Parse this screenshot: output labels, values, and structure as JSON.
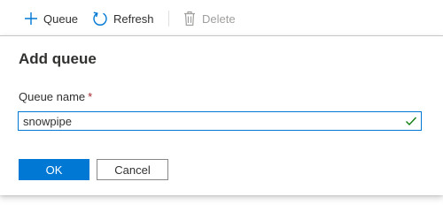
{
  "toolbar": {
    "queue_label": "Queue",
    "refresh_label": "Refresh",
    "delete_label": "Delete"
  },
  "dialog": {
    "title": "Add queue",
    "field_label": "Queue name",
    "required_marker": "*",
    "input_value": "snowpipe",
    "ok_label": "OK",
    "cancel_label": "Cancel"
  },
  "icons": {
    "add": "plus-icon",
    "refresh": "refresh-icon",
    "delete": "trash-icon",
    "valid": "checkmark-icon"
  },
  "colors": {
    "accent": "#0078d4",
    "success": "#107c10",
    "disabled": "#a19f9d",
    "required": "#a4262c"
  }
}
